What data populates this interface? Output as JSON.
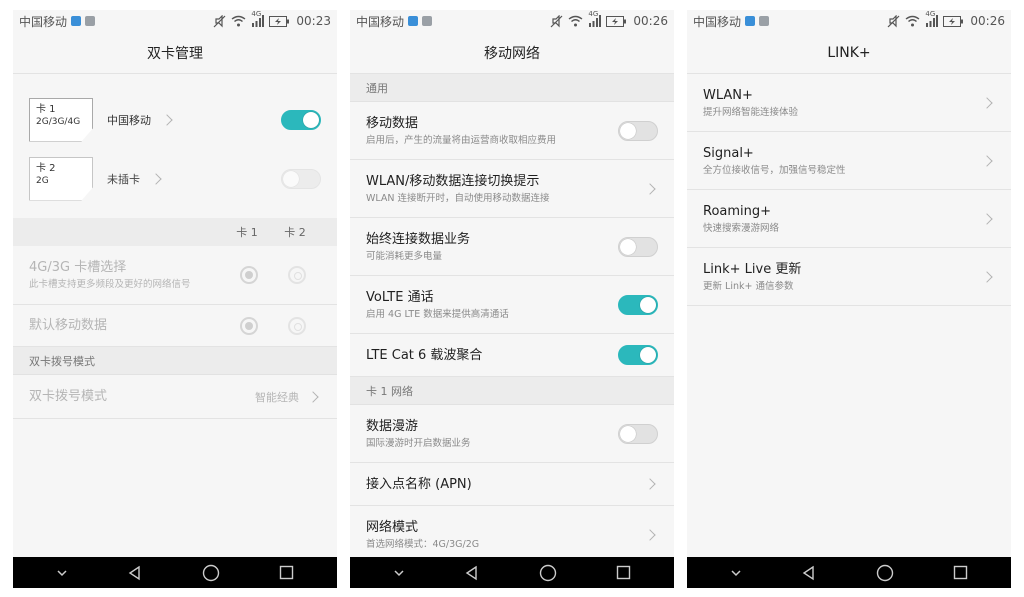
{
  "screens": [
    {
      "status": {
        "carrier": "中国移动",
        "network": "4G",
        "time": "00:23"
      },
      "title": "双卡管理",
      "sims": [
        {
          "name": "卡 1",
          "tech": "2G/3G/4G",
          "label": "中国移动",
          "toggle": "on"
        },
        {
          "name": "卡 2",
          "tech": "2G",
          "label": "未插卡",
          "toggle": "off-disabled"
        }
      ],
      "columns": [
        "卡 1",
        "卡 2"
      ],
      "rows": [
        {
          "title": "4G/3G 卡槽选择",
          "sub": "此卡槽支持更多频段及更好的网络信号"
        },
        {
          "title": "默认移动数据"
        }
      ],
      "section2": "双卡拨号模式",
      "dial": {
        "title": "双卡拨号模式",
        "value": "智能经典"
      }
    },
    {
      "status": {
        "carrier": "中国移动",
        "network": "4G",
        "time": "00:26"
      },
      "title": "移动网络",
      "sections": [
        "通用",
        "卡 1 网络"
      ],
      "rows": [
        {
          "title": "移动数据",
          "sub": "启用后，产生的流量将由运营商收取相应费用",
          "control": "toggle-off"
        },
        {
          "title": "WLAN/移动数据连接切换提示",
          "sub": "WLAN 连接断开时，自动使用移动数据连接",
          "control": "chevron"
        },
        {
          "title": "始终连接数据业务",
          "sub": "可能消耗更多电量",
          "control": "toggle-off"
        },
        {
          "title": "VoLTE 通话",
          "sub": "启用 4G LTE 数据来提供高清通话",
          "control": "toggle-on"
        },
        {
          "title": "LTE Cat 6 载波聚合",
          "control": "toggle-on"
        },
        {
          "title": "数据漫游",
          "sub": "国际漫游时开启数据业务",
          "control": "toggle-off"
        },
        {
          "title": "接入点名称 (APN)",
          "control": "chevron"
        },
        {
          "title": "网络模式",
          "sub": "首选网络模式：4G/3G/2G",
          "control": "chevron"
        }
      ]
    },
    {
      "status": {
        "carrier": "中国移动",
        "network": "4G",
        "time": "00:26"
      },
      "title": "LINK+",
      "rows": [
        {
          "title": "WLAN+",
          "sub": "提升网络智能连接体验"
        },
        {
          "title": "Signal+",
          "sub": "全方位接收信号，加强信号稳定性"
        },
        {
          "title": "Roaming+",
          "sub": "快速搜索漫游网络"
        },
        {
          "title": "Link+ Live 更新",
          "sub": "更新 Link+ 通信参数"
        }
      ]
    }
  ],
  "accent_color": "#2bb8bc",
  "icons": [
    "mute-icon",
    "wifi-icon",
    "signal-icon",
    "battery-icon",
    "back-icon",
    "home-icon",
    "recents-icon",
    "hide-nav-icon"
  ]
}
